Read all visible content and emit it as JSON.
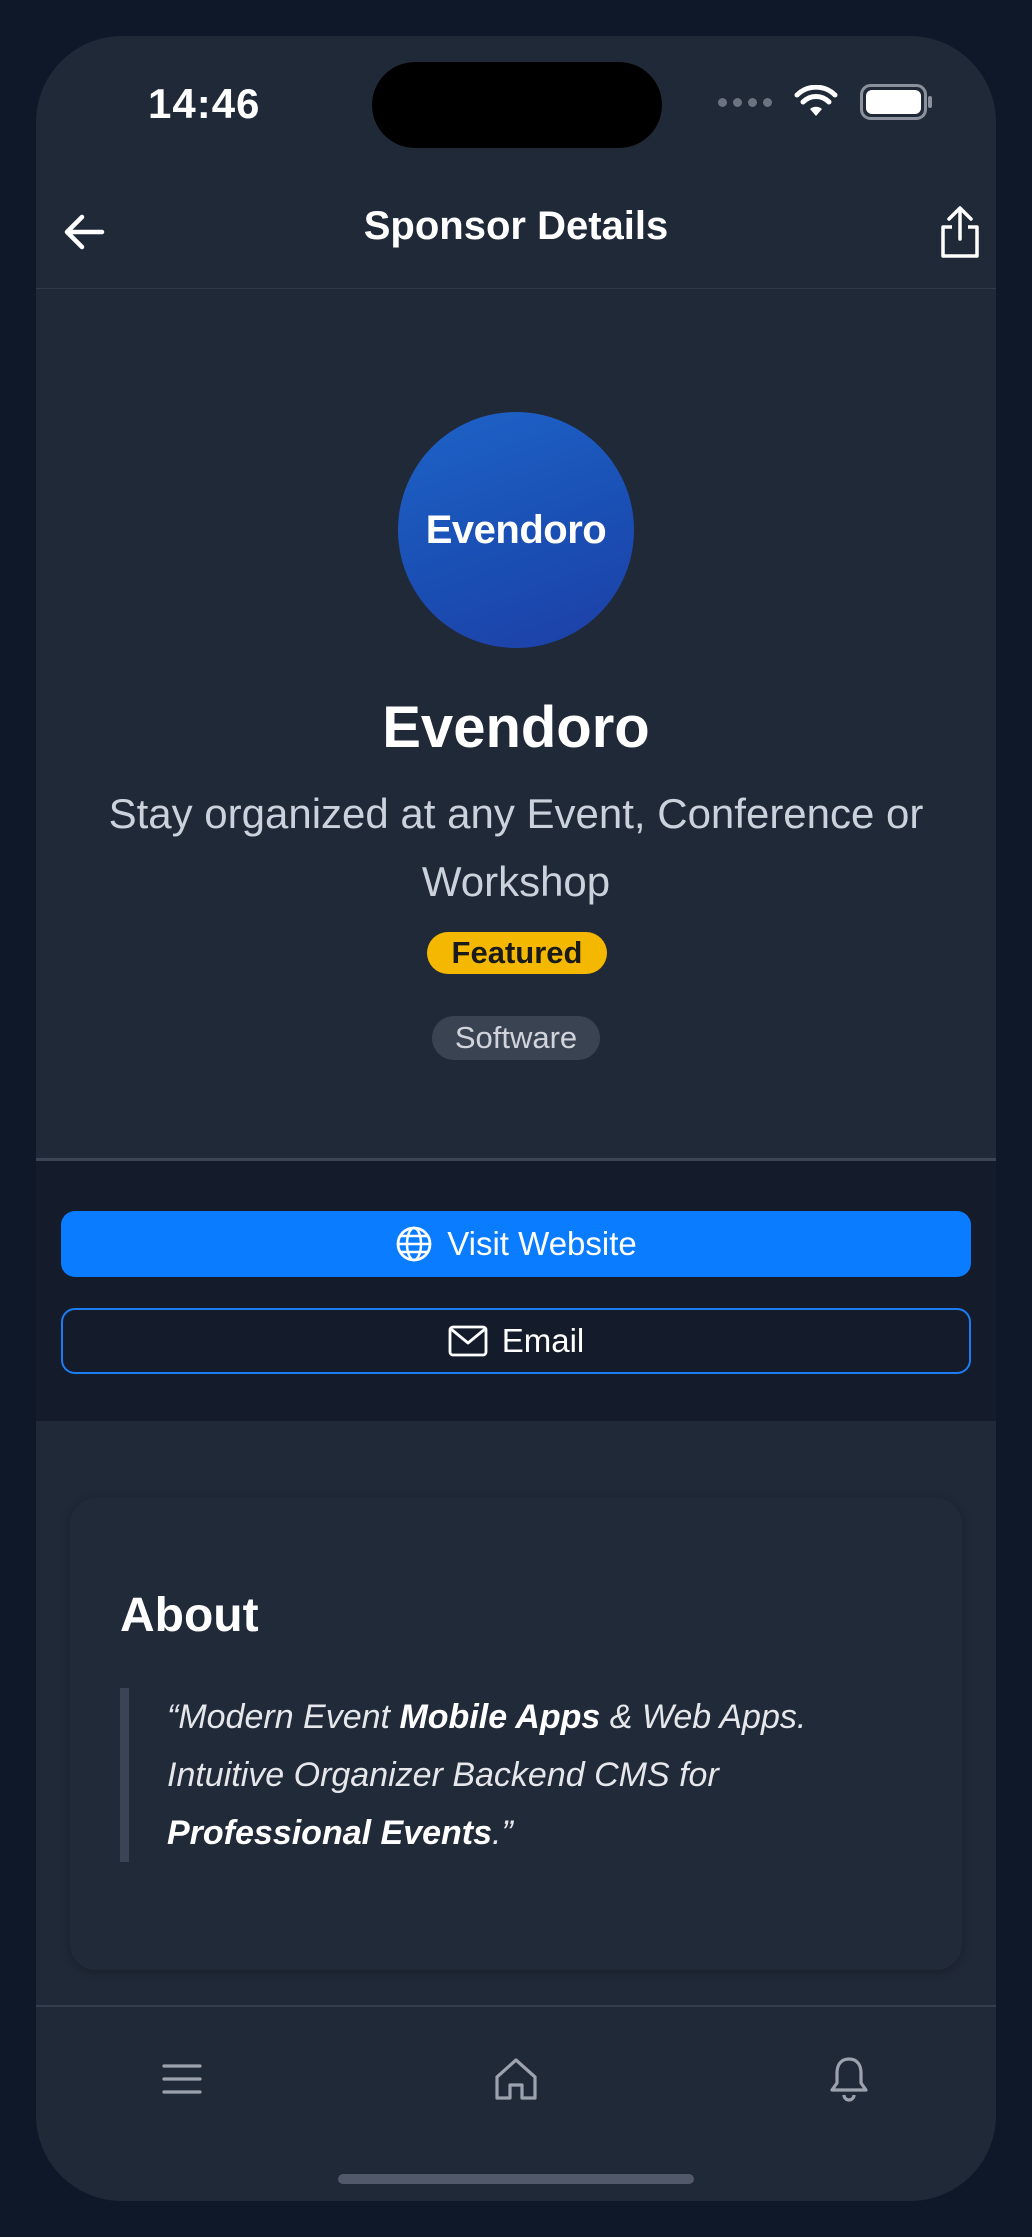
{
  "status_bar": {
    "time": "14:46"
  },
  "header": {
    "title": "Sponsor Details"
  },
  "sponsor": {
    "logo_text": "Evendoro",
    "name": "Evendoro",
    "tagline": "Stay organized at any Event, Conference or Workshop",
    "badge": "Featured",
    "category": "Software"
  },
  "actions": {
    "website_label": "Visit Website",
    "email_label": "Email"
  },
  "about": {
    "title": "About",
    "quote": {
      "open": "“Modern Event ",
      "b1": "Mobile Apps",
      "t2": " & Web Apps. Intuitive Organizer Backend CMS for ",
      "b2": "Professional Events",
      "close": ".”"
    }
  },
  "colors": {
    "background": "#202938",
    "accent": "#0a7cff",
    "featured": "#f5b800"
  },
  "icons": [
    "arrow-left-icon",
    "share-icon",
    "globe-icon",
    "envelope-icon",
    "menu-icon",
    "home-icon",
    "bell-icon"
  ]
}
